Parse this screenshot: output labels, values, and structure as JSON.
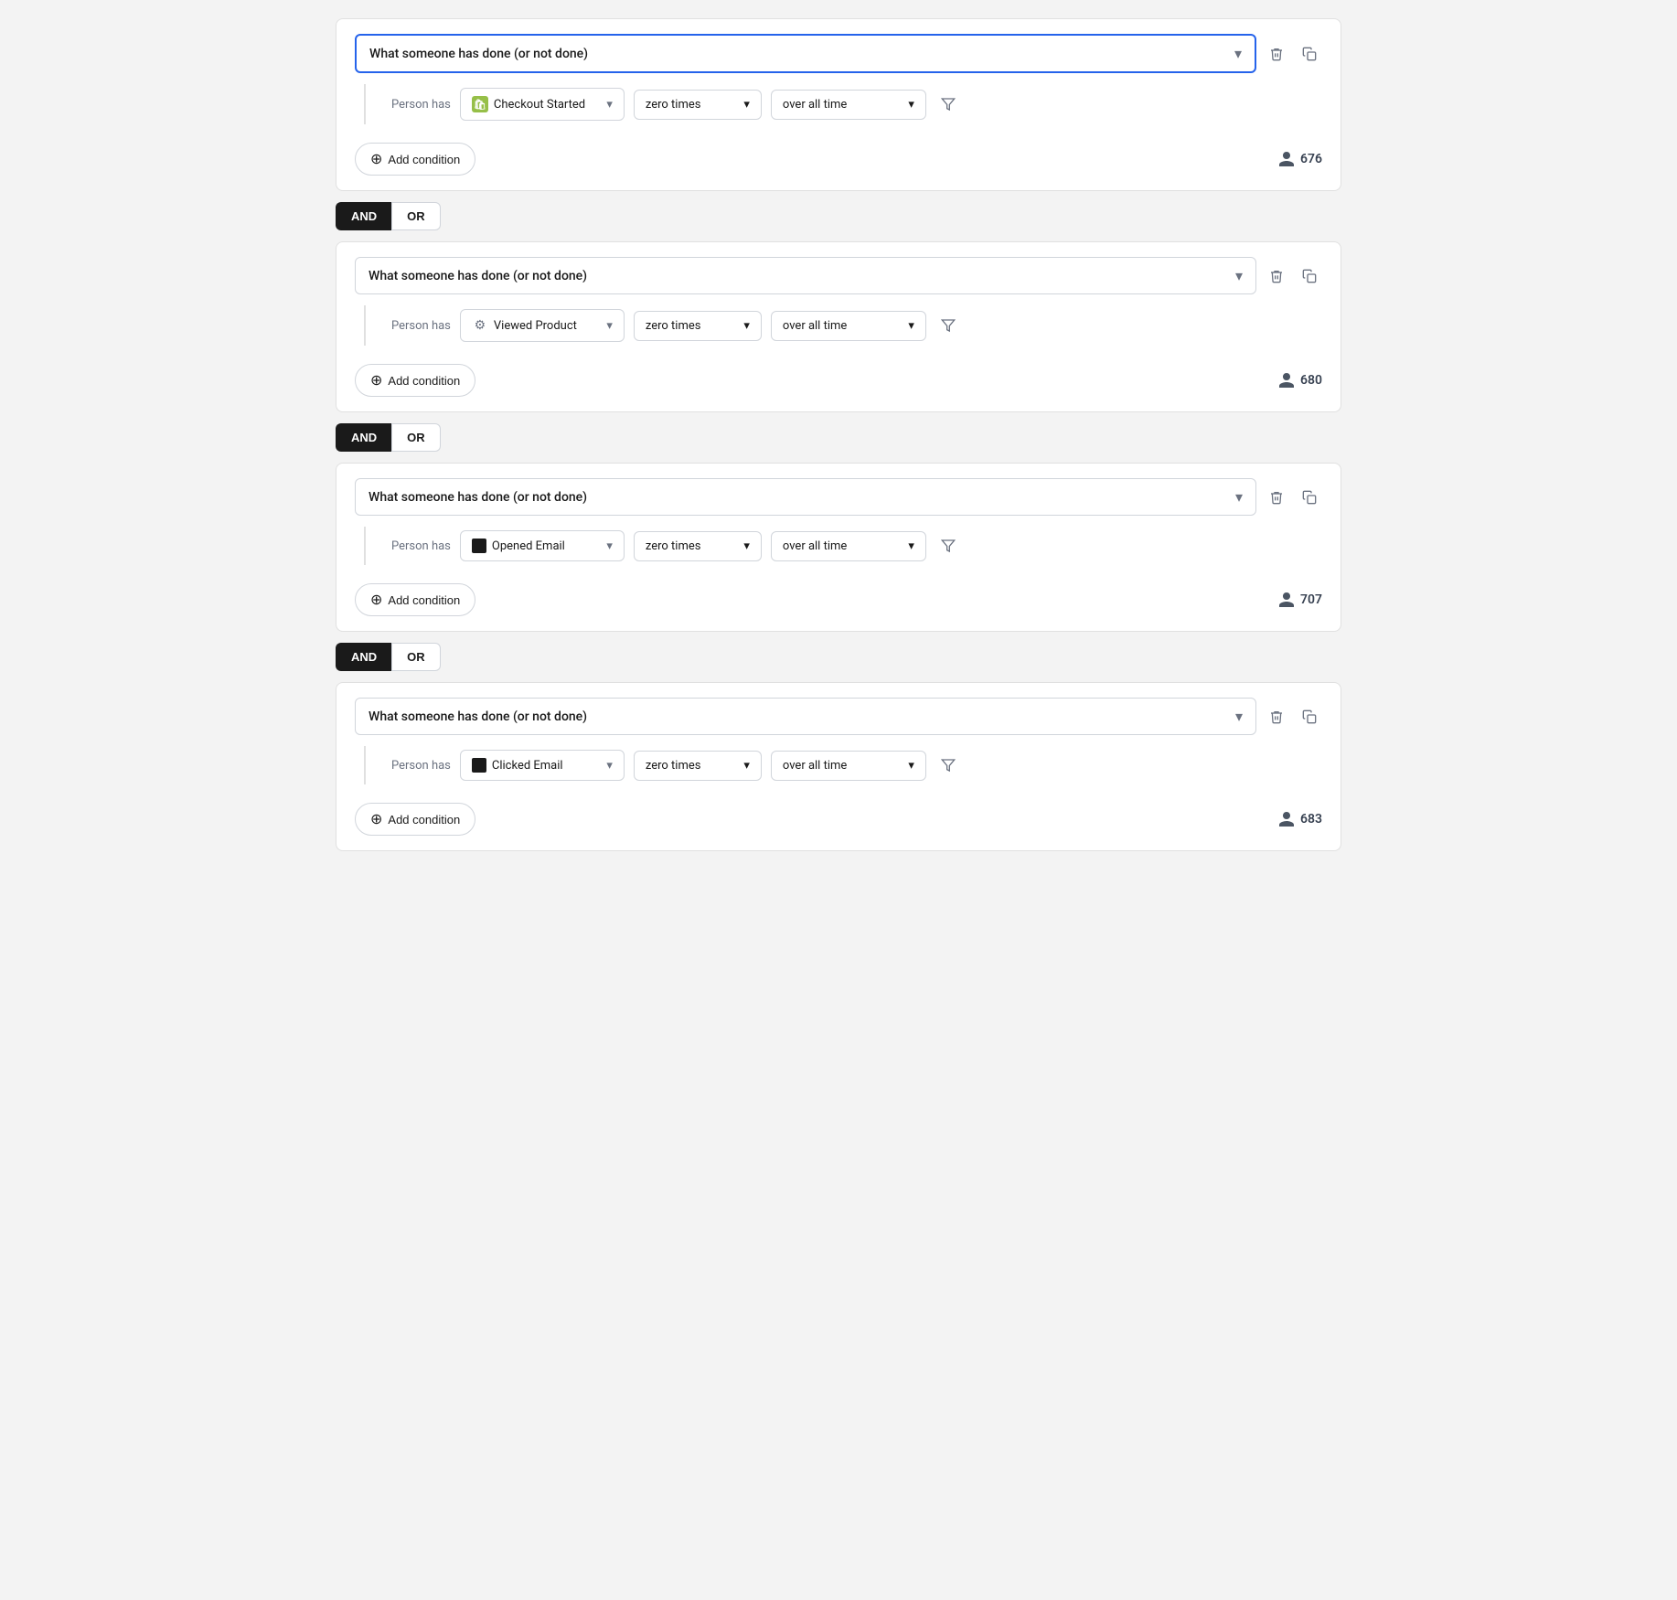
{
  "blocks": [
    {
      "id": "block1",
      "mainDropdown": "What someone has done (or not done)",
      "personHasLabel": "Person has",
      "event": {
        "iconType": "shopify",
        "label": "Checkout Started"
      },
      "frequency": "zero times",
      "timeRange": "over all time",
      "count": "676",
      "addConditionLabel": "Add condition"
    },
    {
      "id": "block2",
      "mainDropdown": "What someone has done (or not done)",
      "personHasLabel": "Person has",
      "event": {
        "iconType": "gear",
        "label": "Viewed Product"
      },
      "frequency": "zero times",
      "timeRange": "over all time",
      "count": "680",
      "addConditionLabel": "Add condition"
    },
    {
      "id": "block3",
      "mainDropdown": "What someone has done (or not done)",
      "personHasLabel": "Person has",
      "event": {
        "iconType": "black-square",
        "label": "Opened Email"
      },
      "frequency": "zero times",
      "timeRange": "over all time",
      "count": "707",
      "addConditionLabel": "Add condition"
    },
    {
      "id": "block4",
      "mainDropdown": "What someone has done (or not done)",
      "personHasLabel": "Person has",
      "event": {
        "iconType": "black-square",
        "label": "Clicked Email"
      },
      "frequency": "zero times",
      "timeRange": "over all time",
      "count": "683",
      "addConditionLabel": "Add condition"
    }
  ],
  "andOrSeparator": {
    "andLabel": "AND",
    "orLabel": "OR"
  },
  "icons": {
    "chevronDown": "▾",
    "delete": "🗑",
    "copy": "⧉",
    "filter": "⛉",
    "plusCircle": "⊕",
    "person": "👤"
  }
}
